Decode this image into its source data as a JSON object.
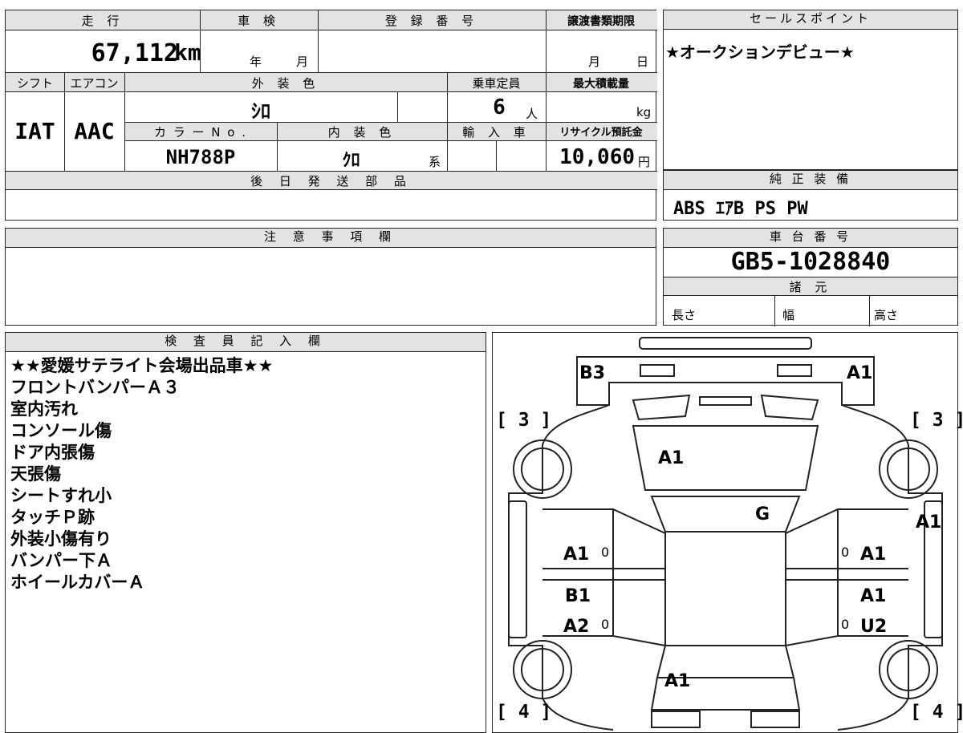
{
  "vehicle": {
    "mileage_header": "走 行",
    "mileage_value": "67,112",
    "mileage_unit": "km",
    "inspection_header": "車 検",
    "inspection_year_label": "年",
    "inspection_month_label": "月",
    "registration_header": "登 録 番 号",
    "transfer_header": "譲渡書類期限",
    "transfer_month_label": "月",
    "transfer_day_label": "日",
    "shift_header": "シフト",
    "shift_value": "IAT",
    "ac_header": "エアコン",
    "ac_value": "AAC",
    "exterior_header": "外 装 色",
    "exterior_value": "ｼﾛ",
    "capacity_header": "乗車定員",
    "capacity_value": "6",
    "capacity_unit": "人",
    "load_header": "最大積載量",
    "load_unit": "kg",
    "color_no_header": "カ ラ ー N o .",
    "color_no_value": "NH788P",
    "interior_header": "内 装 色",
    "interior_value": "ｸﾛ",
    "interior_suffix": "系",
    "import_header": "輸 入 車",
    "recycle_header": "リサイクル預託金",
    "recycle_value": "10,060",
    "recycle_unit": "円",
    "later_parts_header": "後 日 発 送 部 品"
  },
  "sales_point": {
    "header": "セールスポイント",
    "text": "★オークションデビュー★"
  },
  "equipment": {
    "header": "純 正 装 備",
    "text": "ABS ｴｱB PS PW"
  },
  "notes": {
    "header": "注 意 事 項 欄"
  },
  "chassis": {
    "header": "車 台 番 号",
    "value": "GB5-1028840",
    "spec_header": "諸 元",
    "length_label": "長さ",
    "width_label": "幅",
    "height_label": "高さ"
  },
  "inspector": {
    "header": "検 査 員 記 入 欄",
    "remarks": [
      "★★愛媛サテライト会場出品車★★",
      "フロントバンパーＡ３",
      "室内汚れ",
      "コンソール傷",
      "ドア内張傷",
      "天張傷",
      "シートすれ小",
      "タッチＰ跡",
      "外装小傷有り",
      "バンパー下Ａ",
      "ホイールカバーＡ"
    ]
  },
  "diagram": {
    "marks": {
      "front_left": "B3",
      "front_right": "A1",
      "bracket_tl": "[ 3 ]",
      "bracket_tr": "[ 3 ]",
      "bracket_bl": "[ 4 ]",
      "bracket_br": "[ 4 ]",
      "hood": "A1",
      "windshield": "G",
      "right_fender": "A1",
      "left_front_door": "A1",
      "right_front_door": "A1",
      "left_rear_door_upper": "B1",
      "left_rear_door_lower": "A2",
      "right_rear_door_upper": "A1",
      "right_rear_door_lower": "U2",
      "roof_rear": "A1",
      "door_tick": "0"
    }
  }
}
